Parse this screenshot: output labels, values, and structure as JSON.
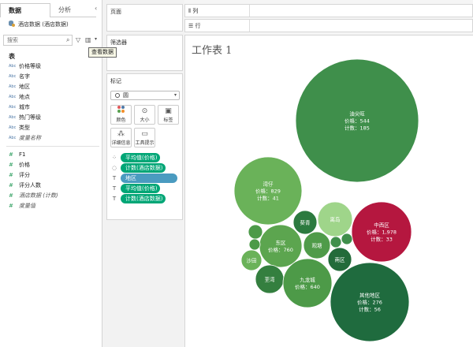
{
  "data_pane": {
    "tabs": [
      "数据",
      "分析"
    ],
    "collapse_glyph": "‹",
    "datasource": "酒店数据 (酒店数据)",
    "search_placeholder": "搜索",
    "view_data_tooltip": "查看数据",
    "tables_heading": "表",
    "dimensions": [
      {
        "type": "Abc",
        "name": "价格等级",
        "italic": false
      },
      {
        "type": "Abc",
        "name": "名字",
        "italic": false
      },
      {
        "type": "Abc",
        "name": "地区",
        "italic": false
      },
      {
        "type": "Abc",
        "name": "地点",
        "italic": false
      },
      {
        "type": "Abc",
        "name": "城市",
        "italic": false
      },
      {
        "type": "Abc",
        "name": "热门等级",
        "italic": false
      },
      {
        "type": "Abc",
        "name": "类型",
        "italic": false
      },
      {
        "type": "Abc",
        "name": "度量名称",
        "italic": true
      }
    ],
    "measures": [
      {
        "type": "#",
        "name": "F1",
        "italic": false
      },
      {
        "type": "#",
        "name": "价格",
        "italic": false
      },
      {
        "type": "#",
        "name": "评分",
        "italic": false
      },
      {
        "type": "#",
        "name": "评分人数",
        "italic": false
      },
      {
        "type": "#",
        "name": "酒店数据 (计数)",
        "italic": true
      },
      {
        "type": "#",
        "name": "度量值",
        "italic": true
      }
    ]
  },
  "cards": {
    "pages_title": "页面",
    "filters_title": "筛选器",
    "marks_title": "标记",
    "mark_type": "圆",
    "buttons": {
      "color": "颜色",
      "size": "大小",
      "label": "标签",
      "detail": "详细信息",
      "tooltip": "工具提示"
    },
    "mark_pills": [
      {
        "icon": "color",
        "label": "平均值(价格)",
        "kind": "measure"
      },
      {
        "icon": "size",
        "label": "计数(酒店数据)",
        "kind": "measure"
      },
      {
        "icon": "label",
        "label": "地区",
        "kind": "dim"
      },
      {
        "icon": "label",
        "label": "平均值(价格)",
        "kind": "measure"
      },
      {
        "icon": "label",
        "label": "计数(酒店数据)",
        "kind": "measure"
      }
    ]
  },
  "shelves": {
    "columns": "列",
    "rows": "行"
  },
  "sheet_title": "工作表 1",
  "chart_data": {
    "type": "packed-bubble",
    "size_measure": "计数(酒店数据)",
    "color_measure": "平均值(价格)",
    "colors": {
      "low": "#1f6b3e",
      "mid": "#6ab259",
      "high": "#b5173f"
    },
    "bubbles": [
      {
        "name": "油尖旺",
        "price": "544",
        "count": "185",
        "count_value": 185,
        "color": "#3f8f4b",
        "labels": true
      },
      {
        "name": "湾仔",
        "price": "829",
        "count": "41",
        "count_value": 41,
        "color": "#6ab259",
        "labels": true
      },
      {
        "name": "葵青",
        "count_value": 10,
        "color": "#2c7a3f",
        "labels": false
      },
      {
        "name": "离岛",
        "count_value": 15,
        "color": "#9fd58a",
        "labels": false
      },
      {
        "name": "中西区",
        "price": "1,978",
        "count": "33",
        "count_value": 33,
        "color": "#b5173f",
        "labels": true
      },
      {
        "name": "东区",
        "price": "760",
        "count_value": 24,
        "color": "#5ca54f",
        "labels": "price_only"
      },
      {
        "name": "观塘",
        "count_value": 11,
        "color": "#4f9b49",
        "labels": false
      },
      {
        "name": "南区",
        "count_value": 7,
        "color": "#236b3a",
        "labels": false
      },
      {
        "name": "沙田",
        "count_value": 6,
        "color": "#6ab259",
        "labels": false
      },
      {
        "name": "荃湾",
        "count_value": 11,
        "color": "#347f3f",
        "labels": false
      },
      {
        "name": "九龙城",
        "price": "640",
        "count_value": 33,
        "color": "#4d9a48",
        "labels": "price_only"
      },
      {
        "name": "其他地区",
        "price": "276",
        "count": "56",
        "count_value": 56,
        "color": "#1f6b3e",
        "labels": true
      },
      {
        "name": "",
        "count_value": 3,
        "color": "#4c9a48",
        "labels": false
      },
      {
        "name": "",
        "count_value": 2,
        "color": "#4c9a48",
        "labels": false
      },
      {
        "name": "",
        "count_value": 2,
        "color": "#3f8f4b",
        "labels": false
      },
      {
        "name": "",
        "count_value": 2,
        "color": "#3f8f4b",
        "labels": false
      }
    ],
    "label_prefixes": {
      "price": "价格：",
      "count": "计数："
    }
  }
}
